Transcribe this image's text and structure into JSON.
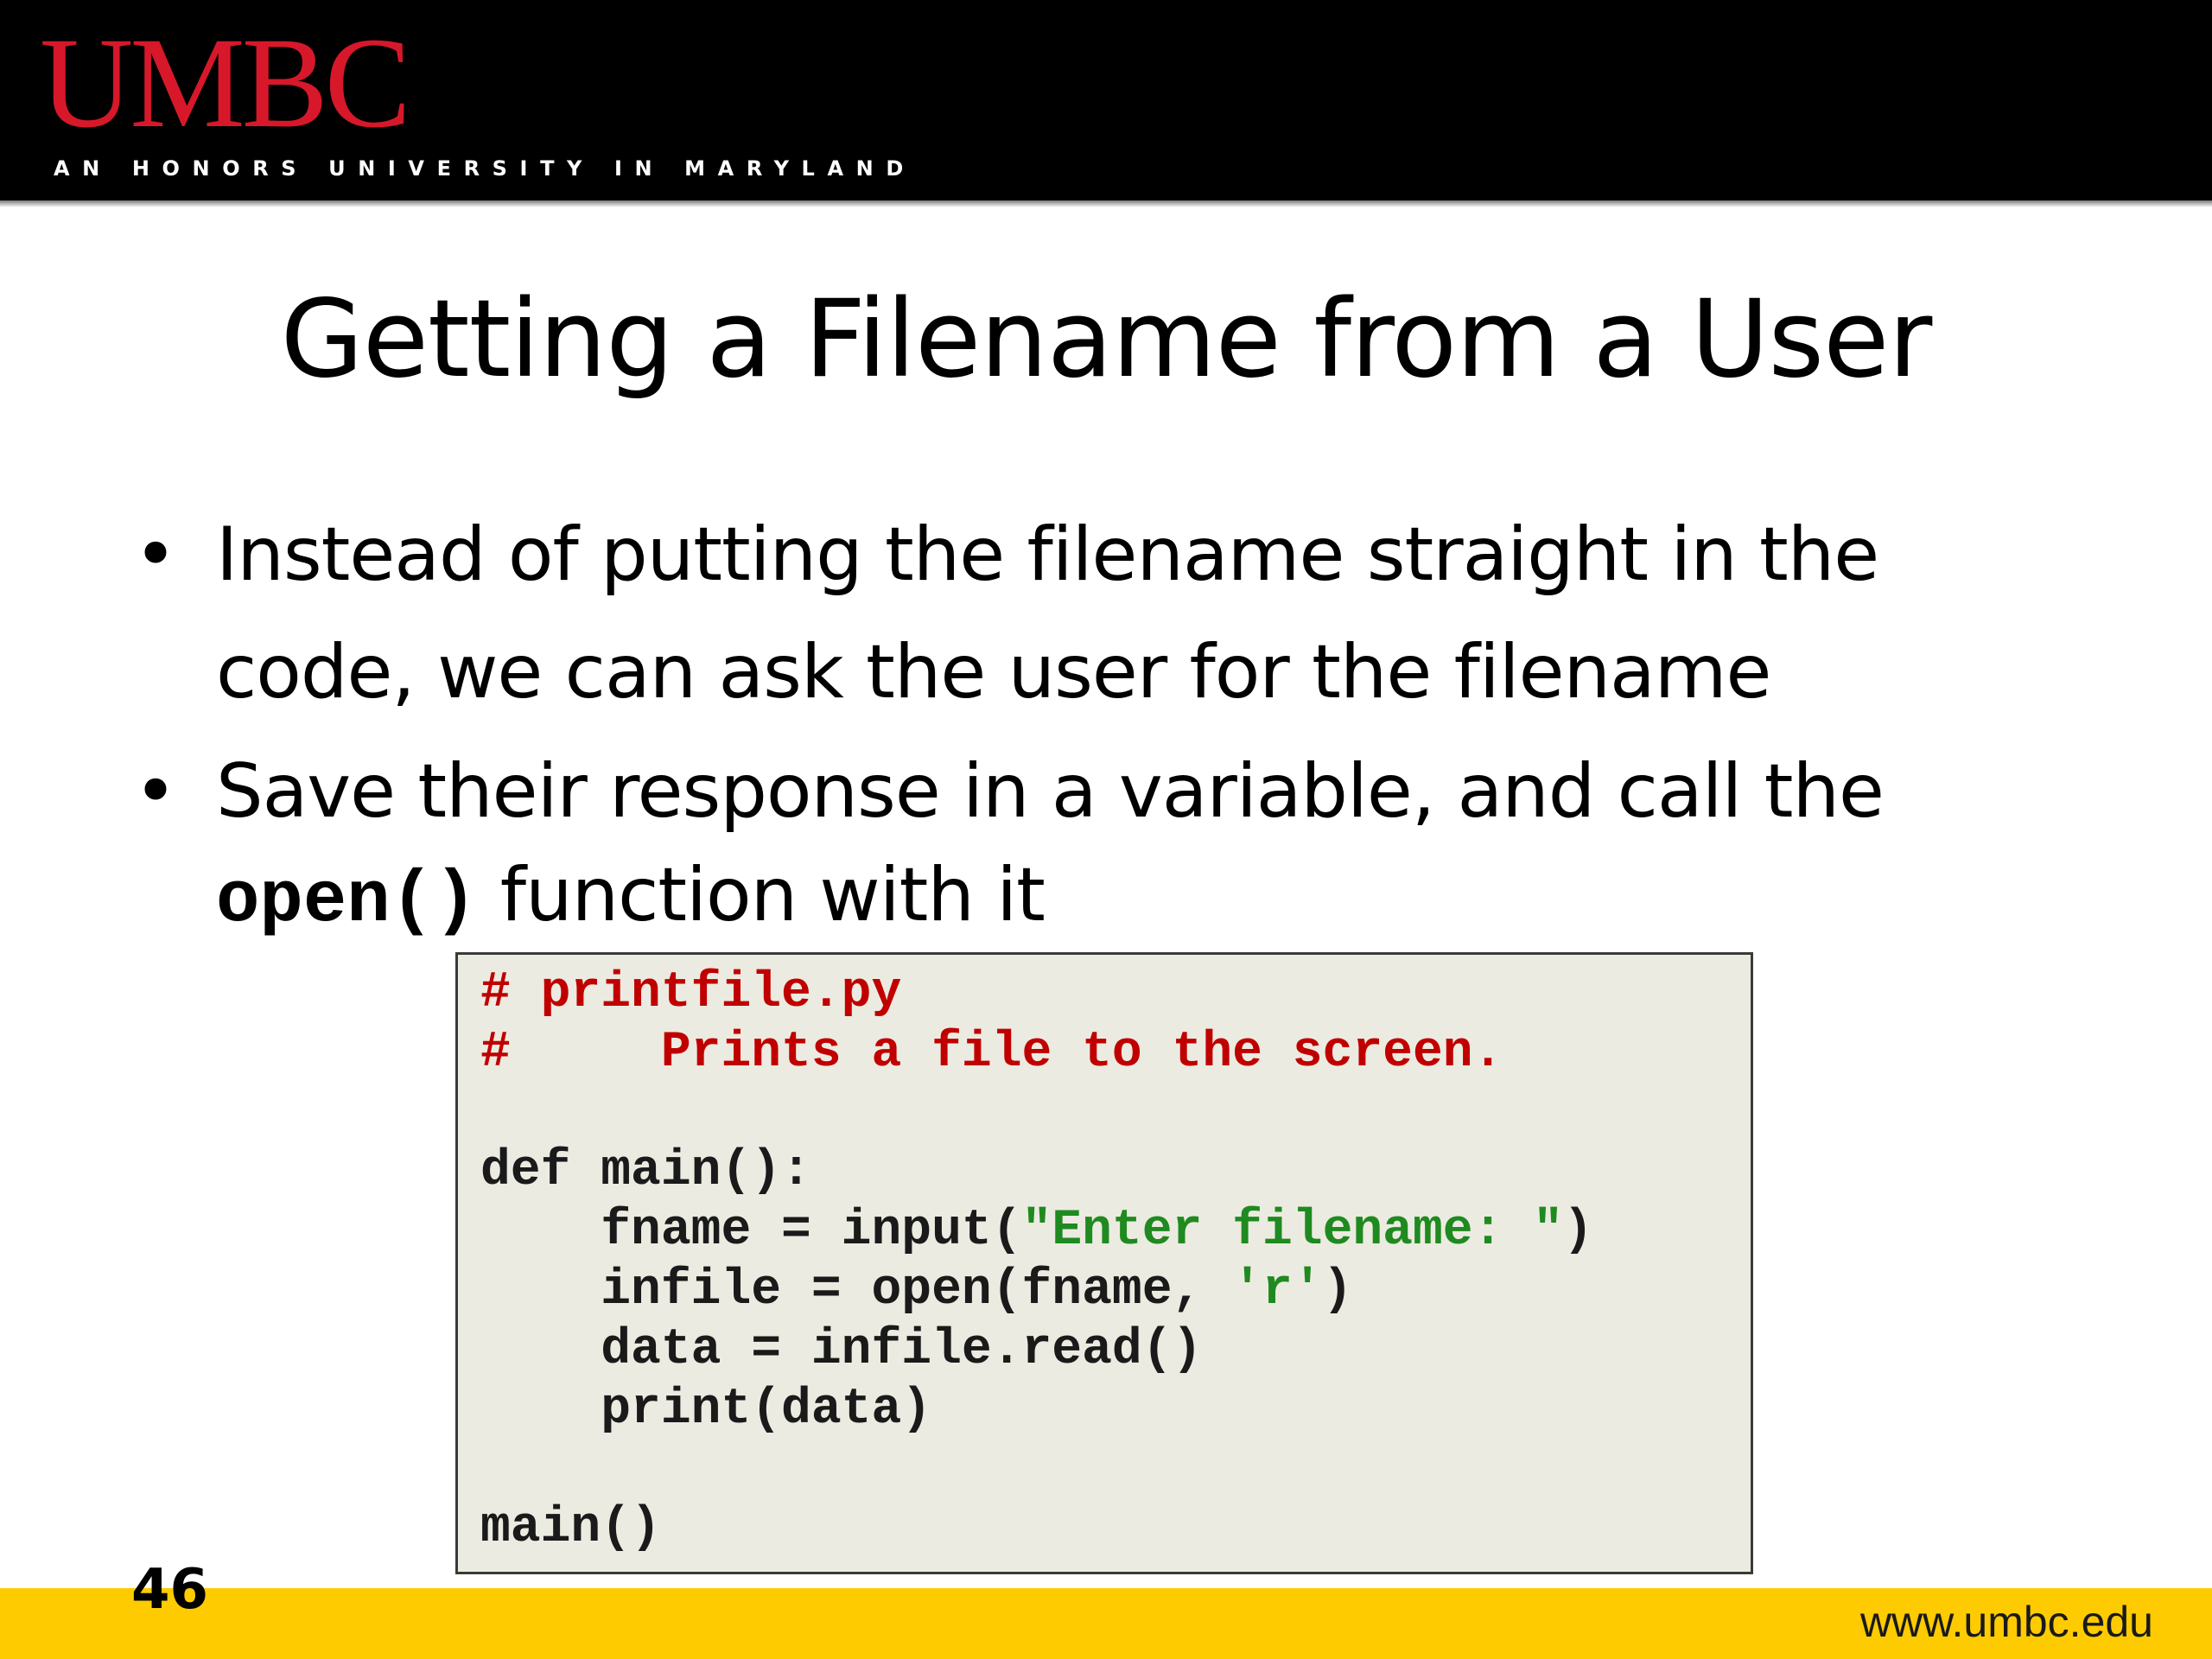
{
  "header": {
    "logo_text": "UMBC",
    "tagline": "AN HONORS UNIVERSITY IN MARYLAND",
    "logo_color": "#d7182a",
    "background_color": "#000000"
  },
  "slide": {
    "title": "Getting a Filename from a User",
    "bullets": [
      {
        "lines": [
          "Instead of putting the filename straight in the",
          "code, we can ask the user for the filename"
        ]
      },
      {
        "line1": "Save their response in a variable, and call the",
        "code": "open()",
        "line2_rest": " function with it"
      }
    ],
    "bullet_glyph": "•"
  },
  "code_block": {
    "background_color": "#ecebe1",
    "comment_color": "#c00000",
    "string_color": "#1f8a1f",
    "comment1": "# printfile.py",
    "comment2": "#     Prints a file to the screen.",
    "def_line": "def main():",
    "line_input_pre": "    fname = input(",
    "line_input_str": "\"Enter filename: \"",
    "line_input_post": ")",
    "line_open_pre": "    infile = open(fname, ",
    "line_open_str": "'r'",
    "line_open_post": ")",
    "line_read": "    data = infile.read()",
    "line_print": "    print(data)",
    "line_call": "main()"
  },
  "footer": {
    "page_number": "46",
    "url": "www.umbc.edu",
    "background_color": "#fecb00"
  }
}
